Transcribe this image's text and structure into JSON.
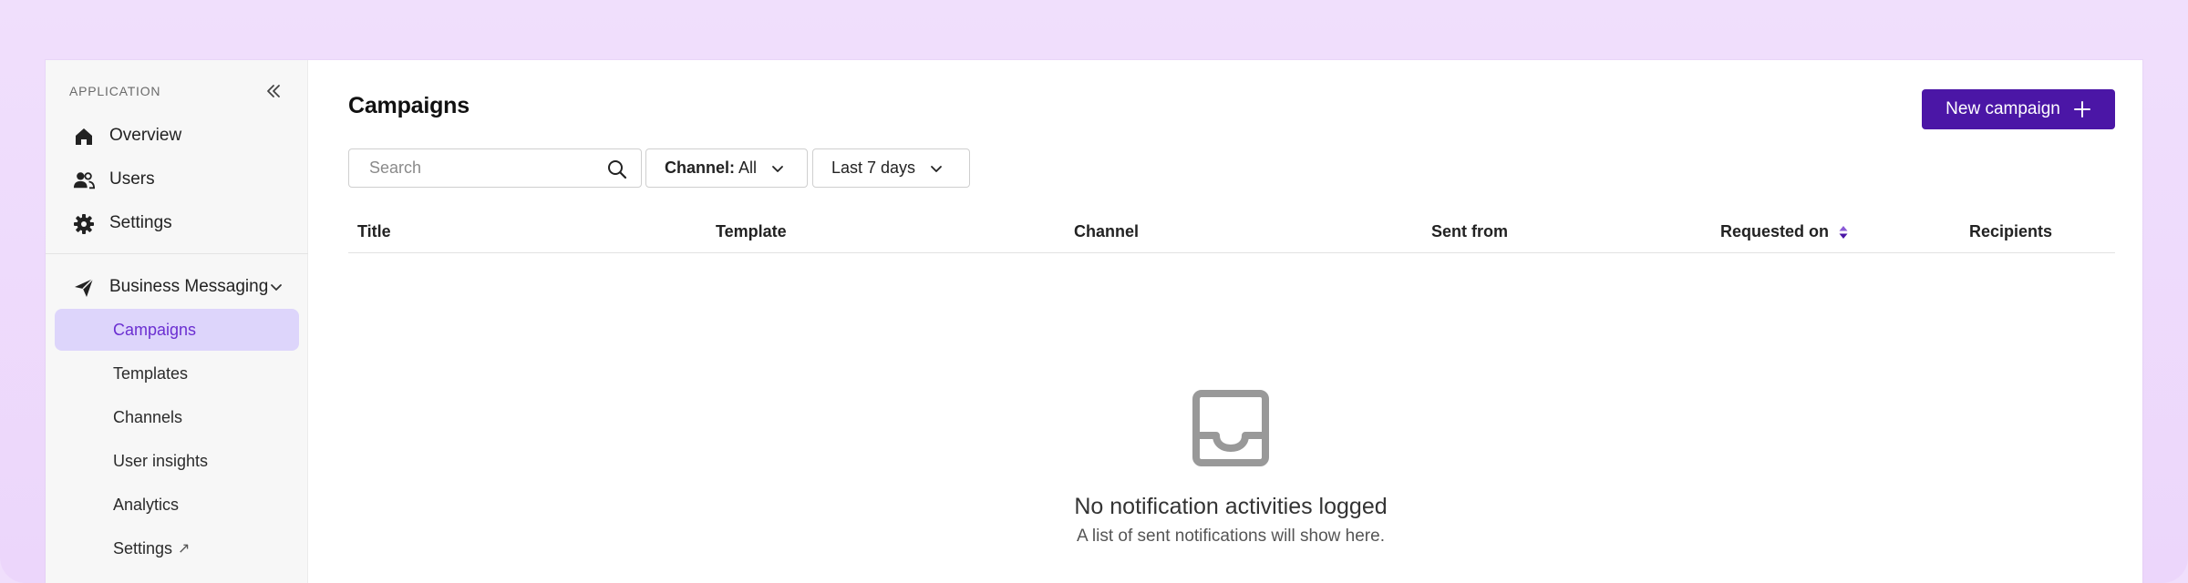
{
  "sidebar": {
    "section_label": "APPLICATION",
    "items": [
      {
        "label": "Overview",
        "icon": "home-icon"
      },
      {
        "label": "Users",
        "icon": "users-icon"
      },
      {
        "label": "Settings",
        "icon": "gear-icon"
      }
    ],
    "group": {
      "label": "Business Messaging",
      "icon": "paper-plane-icon",
      "expanded": true
    },
    "sub_items": [
      {
        "label": "Campaigns",
        "active": true
      },
      {
        "label": "Templates"
      },
      {
        "label": "Channels"
      },
      {
        "label": "User insights"
      },
      {
        "label": "Analytics"
      },
      {
        "label": "Settings",
        "external_icon": "↗"
      }
    ]
  },
  "header": {
    "title": "Campaigns",
    "new_button_label": "New campaign"
  },
  "filters": {
    "search_placeholder": "Search",
    "channel_label": "Channel:",
    "channel_value": "All",
    "date_range": "Last 7 days"
  },
  "table": {
    "columns": [
      "Title",
      "Template",
      "Channel",
      "Sent from",
      "Requested on",
      "Recipients"
    ]
  },
  "empty_state": {
    "title": "No notification activities logged",
    "subtitle": "A list of sent notifications will show here."
  },
  "colors": {
    "accent": "#4b16a6",
    "active_bg": "#ddd5fb",
    "active_text": "#6b2fd1",
    "frame_bg": "#f0dffc"
  }
}
